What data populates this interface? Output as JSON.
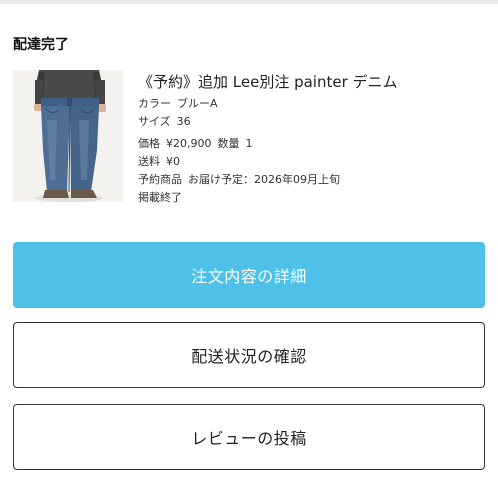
{
  "order": {
    "status": "配達完了"
  },
  "product": {
    "name": "《予約》追加 Lee別注 painter デニム",
    "color_label": "カラー",
    "color_value": "ブルーA",
    "size_label": "サイズ",
    "size_value": "36",
    "price_label": "価格",
    "price_value": "¥20,900",
    "quantity_label": "数量",
    "quantity_value": "1",
    "shipping_label": "送料",
    "shipping_value": "¥0",
    "preorder_label": "予約商品",
    "preorder_value": "お届け予定：2026年09月上旬",
    "listing_status": "掲載終了"
  },
  "actions": {
    "order_details": "注文内容の詳細",
    "shipping_status": "配送状況の確認",
    "write_review": "レビューの投稿"
  },
  "colors": {
    "primary_button": "#4dc1e8",
    "button_text_primary": "#ffffff",
    "outline_border": "#333333"
  },
  "icons": {
    "product_thumbnail": "denim-jeans-model-photo"
  }
}
